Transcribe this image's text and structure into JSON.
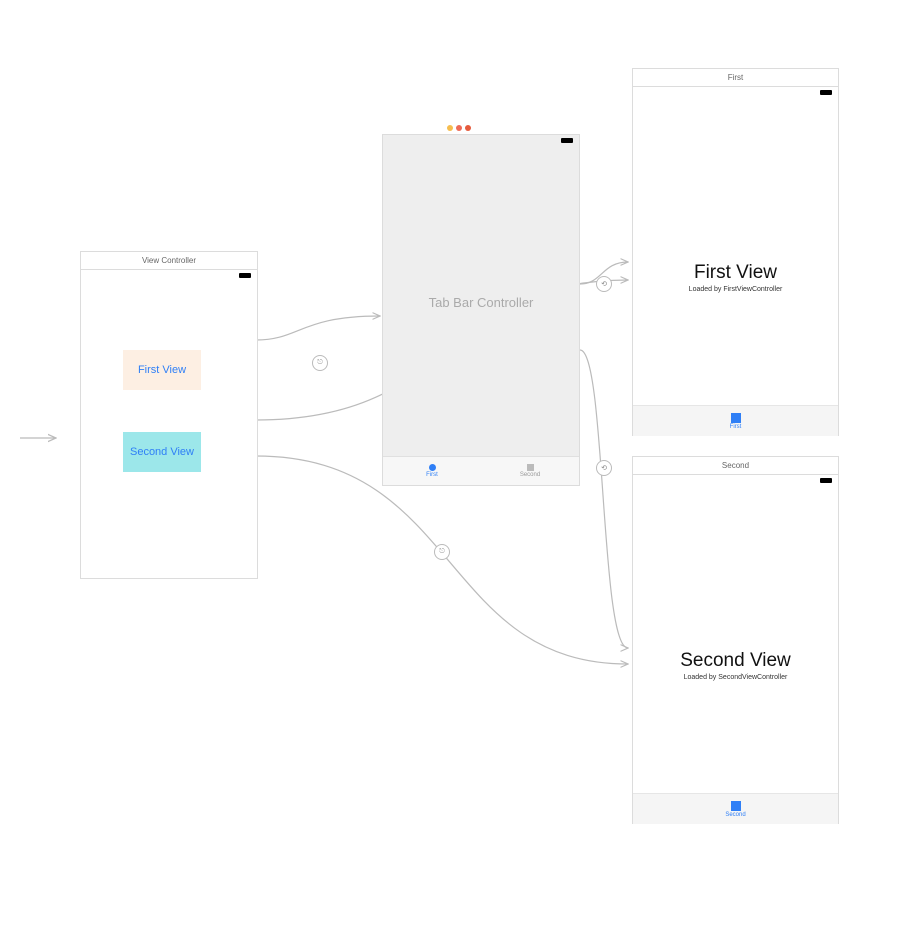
{
  "scene1": {
    "title": "View Controller",
    "button1": "First View",
    "button2": "Second View"
  },
  "scene2": {
    "label": "Tab Bar Controller",
    "tab1": "First",
    "tab2": "Second"
  },
  "scene3": {
    "title": "First",
    "heading": "First View",
    "sub": "Loaded by FirstViewController",
    "tab": "First"
  },
  "scene4": {
    "title": "Second",
    "heading": "Second View",
    "sub": "Loaded by SecondViewController",
    "tab": "Second"
  }
}
